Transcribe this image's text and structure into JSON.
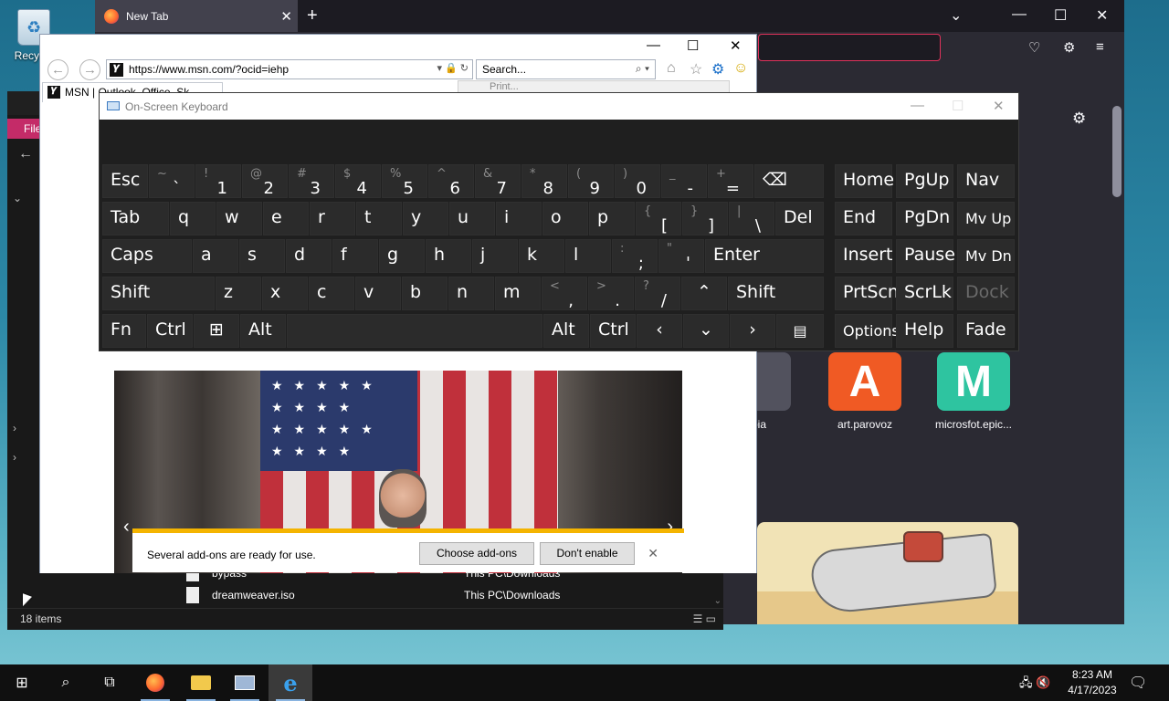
{
  "desktop": {
    "recycle_label": "Recycle"
  },
  "firefox": {
    "tab_title": "New Tab",
    "tab_close": "✕",
    "new_tab": "+",
    "controls": {
      "list": "⌄",
      "min": "—",
      "max": "☐",
      "close": "✕"
    },
    "shortcuts": [
      {
        "label": "art.parovoz",
        "letter": "A",
        "color": "#f05a24"
      },
      {
        "label": "microsfot.epic...",
        "letter": "M",
        "color": "#2ec4a0"
      }
    ],
    "partial_shortcut_label": "mbia"
  },
  "explorer": {
    "file_tab": "File",
    "rows": [
      {
        "name": "bypass",
        "location": "This PC\\Downloads"
      },
      {
        "name": "dreamweaver.iso",
        "location": "This PC\\Downloads"
      }
    ],
    "status": "18 items"
  },
  "ie": {
    "controls": {
      "min": "—",
      "max": "☐",
      "close": "✕"
    },
    "address": "https://www.msn.com/?ocid=iehp",
    "search_placeholder": "Search...",
    "tab_title": "MSN | Outlook, Office, Sk",
    "print_label": "Print...",
    "notification": {
      "message": "Several add-ons are ready for use.",
      "choose": "Choose add-ons",
      "dont": "Don't enable",
      "close": "✕"
    }
  },
  "osk": {
    "title": "On-Screen Keyboard",
    "keys": {
      "esc": "Esc",
      "tab": "Tab",
      "caps": "Caps",
      "shift": "Shift",
      "fn": "Fn",
      "ctrl": "Ctrl",
      "alt": "Alt",
      "del": "Del",
      "enter": "Enter",
      "home": "Home",
      "pgup": "PgUp",
      "nav": "Nav",
      "end": "End",
      "pgdn": "PgDn",
      "mvup": "Mv Up",
      "insert": "Insert",
      "pause": "Pause",
      "mvdn": "Mv Dn",
      "prtscn": "PrtScn",
      "scrlk": "ScrLk",
      "dock": "Dock",
      "options": "Options",
      "help": "Help",
      "fade": "Fade",
      "num": [
        [
          "~",
          "`"
        ],
        [
          "!",
          "1"
        ],
        [
          "@",
          "2"
        ],
        [
          "#",
          "3"
        ],
        [
          "$",
          "4"
        ],
        [
          "%",
          "5"
        ],
        [
          "^",
          "6"
        ],
        [
          "&",
          "7"
        ],
        [
          "*",
          "8"
        ],
        [
          "(",
          "9"
        ],
        [
          ")",
          "0"
        ],
        [
          "_",
          "-"
        ],
        [
          "+",
          "="
        ]
      ],
      "row_q": [
        "q",
        "w",
        "e",
        "r",
        "t",
        "y",
        "u",
        "i",
        "o",
        "p"
      ],
      "row_q_sym": [
        [
          "{",
          "["
        ],
        [
          "}",
          "]"
        ],
        [
          "|",
          "\\"
        ]
      ],
      "row_a": [
        "a",
        "s",
        "d",
        "f",
        "g",
        "h",
        "j",
        "k",
        "l"
      ],
      "row_a_sym": [
        [
          ":",
          ";"
        ],
        [
          "\"",
          "'"
        ]
      ],
      "row_z": [
        "z",
        "x",
        "c",
        "v",
        "b",
        "n",
        "m"
      ],
      "row_z_sym": [
        [
          "<",
          ","
        ],
        [
          ">",
          "."
        ],
        [
          "?",
          "/"
        ]
      ]
    }
  },
  "taskbar": {
    "time": "8:23 AM",
    "date": "4/17/2023"
  }
}
